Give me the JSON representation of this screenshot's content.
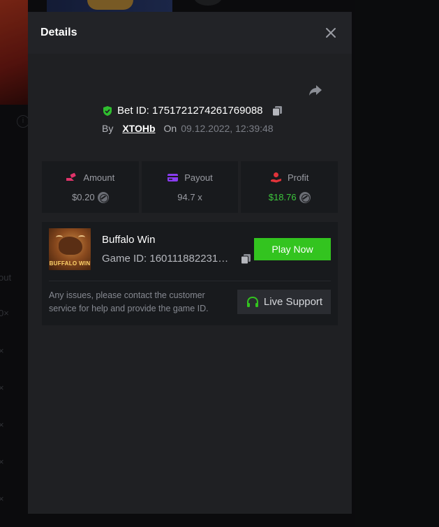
{
  "background": {
    "side_labels": [
      "out",
      "0×",
      "×",
      "×",
      "×",
      "×",
      "×"
    ],
    "info_icon": "info-icon"
  },
  "modal": {
    "title": "Details",
    "close_icon": "close-icon",
    "share_icon": "share-icon"
  },
  "bet": {
    "id_label": "Bet ID: 1751721274261769088",
    "by_label": "By",
    "user": "XTOHb",
    "on_label": "On",
    "date": "09.12.2022, 12:39:48"
  },
  "stats": [
    {
      "label": "Amount",
      "value": "$0.20",
      "icon": "amount-icon",
      "color": "#e0336a"
    },
    {
      "label": "Payout",
      "value": "94.7 x",
      "icon": "payout-icon",
      "color": "#8a3cf0"
    },
    {
      "label": "Profit",
      "value": "$18.76",
      "icon": "profit-icon",
      "color": "#e0333a"
    }
  ],
  "game": {
    "name": "Buffalo Win",
    "thumb_title": "BUFFALO WIN",
    "id_label": "Game ID: 16011188223109...",
    "play_label": "Play Now",
    "support_text": "Any issues, please contact the customer service for help and provide the game ID.",
    "support_label": "Live Support"
  },
  "colors": {
    "accent_green": "#33c41f",
    "profit_green": "#3cc63c",
    "shield_green": "#2fbe2f"
  }
}
